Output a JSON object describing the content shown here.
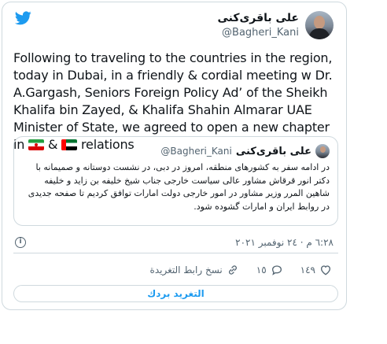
{
  "author": {
    "display_name": "علی باقری‌کنی",
    "handle": "@Bagheri_Kani"
  },
  "tweet": {
    "text_before_flag1": "Following to traveling to the countries in the region, today in Dubai, in a friendly & cordial meeting w Dr. A.Gargash, Seniors Foreign Policy Ad’ of the Sheikh Khalifa bin Zayed, & Khalifa Shahin Almarar UAE Minister of State, we agreed to open a new chapter in",
    "text_between_flags": "&",
    "text_after_flag2": "relations"
  },
  "quoted_tweet": {
    "display_name": "علی باقری‌کنی",
    "handle": "@Bagheri_Kani",
    "text": "در ادامه سفر به کشورهای منطقه، امروز در دبی، در نشست دوستانه و صمیمانه با دکتر انور قرقاش مشاور عالی سیاست خارجی جناب شیخ خلیفه بن زاید و خلیفه شاهین المرر وزیر مشاور در امور خارجی دولت امارات توافق کردیم تا صفحه جدیدی در روابط ایران و امارات گشوده شود."
  },
  "timestamp": "٦:٢٨ م · ٢٤ نوفمبر ٢٠٢١",
  "actions": {
    "likes": "١٤٩",
    "replies": "١٥",
    "copy_link": "نسخ رابط التغريدة"
  },
  "reply_button": "التغريد بردك",
  "icons": {
    "logo": "twitter-bird-icon",
    "info": "info-icon",
    "like": "heart-icon",
    "reply": "reply-icon",
    "link": "link-icon"
  },
  "colors": {
    "brand": "#1d9bf0",
    "secondary_text": "#536471",
    "border": "#cfd9de"
  }
}
